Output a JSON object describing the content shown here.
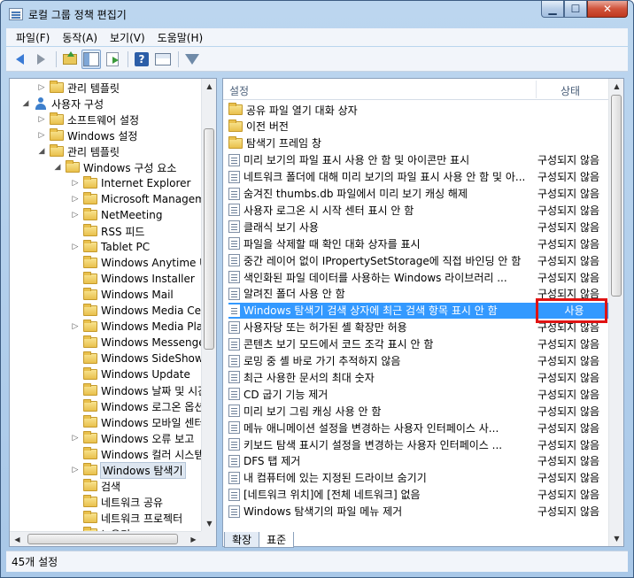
{
  "window": {
    "title": "로컬 그룹 정책 편집기"
  },
  "menu": {
    "items": [
      "파일(F)",
      "동작(A)",
      "보기(V)",
      "도움말(H)"
    ]
  },
  "toolbar": {
    "icons": [
      "back-arrow-icon",
      "forward-arrow-icon",
      "folder-up-icon",
      "console-tree-icon",
      "export-icon",
      "help-icon",
      "view-icon",
      "filter-icon"
    ]
  },
  "tree": {
    "items": [
      {
        "label": "관리 템플릿",
        "indent": 1,
        "toggle": "▷",
        "icon": "folder-icon"
      },
      {
        "label": "사용자 구성",
        "indent": 0,
        "toggle": "◢",
        "icon": "user-icon"
      },
      {
        "label": "소프트웨어 설정",
        "indent": 1,
        "toggle": "▷",
        "icon": "folder-icon"
      },
      {
        "label": "Windows 설정",
        "indent": 1,
        "toggle": "▷",
        "icon": "folder-icon"
      },
      {
        "label": "관리 템플릿",
        "indent": 1,
        "toggle": "◢",
        "icon": "folder-icon"
      },
      {
        "label": "Windows 구성 요소",
        "indent": 2,
        "toggle": "◢",
        "icon": "folder-icon"
      },
      {
        "label": "Internet Explorer",
        "indent": 3,
        "toggle": "▷",
        "icon": "folder-icon"
      },
      {
        "label": "Microsoft Management",
        "indent": 3,
        "toggle": "▷",
        "icon": "folder-icon"
      },
      {
        "label": "NetMeeting",
        "indent": 3,
        "toggle": "▷",
        "icon": "folder-icon"
      },
      {
        "label": "RSS 피드",
        "indent": 3,
        "toggle": "",
        "icon": "folder-icon"
      },
      {
        "label": "Tablet PC",
        "indent": 3,
        "toggle": "▷",
        "icon": "folder-icon"
      },
      {
        "label": "Windows Anytime Upgrade",
        "indent": 3,
        "toggle": "",
        "icon": "folder-icon"
      },
      {
        "label": "Windows Installer",
        "indent": 3,
        "toggle": "",
        "icon": "folder-icon"
      },
      {
        "label": "Windows Mail",
        "indent": 3,
        "toggle": "",
        "icon": "folder-icon"
      },
      {
        "label": "Windows Media Center",
        "indent": 3,
        "toggle": "",
        "icon": "folder-icon"
      },
      {
        "label": "Windows Media Player",
        "indent": 3,
        "toggle": "▷",
        "icon": "folder-icon"
      },
      {
        "label": "Windows Messenger",
        "indent": 3,
        "toggle": "",
        "icon": "folder-icon"
      },
      {
        "label": "Windows SideShow",
        "indent": 3,
        "toggle": "",
        "icon": "folder-icon"
      },
      {
        "label": "Windows Update",
        "indent": 3,
        "toggle": "",
        "icon": "folder-icon"
      },
      {
        "label": "Windows 날짜 및 시간",
        "indent": 3,
        "toggle": "",
        "icon": "folder-icon"
      },
      {
        "label": "Windows 로그온 옵션",
        "indent": 3,
        "toggle": "",
        "icon": "folder-icon"
      },
      {
        "label": "Windows 모바일 센터",
        "indent": 3,
        "toggle": "",
        "icon": "folder-icon"
      },
      {
        "label": "Windows 오류 보고",
        "indent": 3,
        "toggle": "▷",
        "icon": "folder-icon"
      },
      {
        "label": "Windows 컬러 시스템",
        "indent": 3,
        "toggle": "",
        "icon": "folder-icon"
      },
      {
        "label": "Windows 탐색기",
        "indent": 3,
        "toggle": "▷",
        "icon": "folder-icon",
        "selected": true
      },
      {
        "label": "검색",
        "indent": 3,
        "toggle": "",
        "icon": "folder-icon"
      },
      {
        "label": "네트워크 공유",
        "indent": 3,
        "toggle": "",
        "icon": "folder-icon"
      },
      {
        "label": "네트워크 프로젝터",
        "indent": 3,
        "toggle": "",
        "icon": "folder-icon"
      },
      {
        "label": "노우기",
        "indent": 3,
        "toggle": "",
        "icon": "folder-icon"
      }
    ]
  },
  "list": {
    "headers": {
      "setting": "설정",
      "state": "상태"
    },
    "rows": [
      {
        "name": "공유 파일 열기 대화 상자",
        "state": "",
        "type": "folder"
      },
      {
        "name": "이전 버전",
        "state": "",
        "type": "folder"
      },
      {
        "name": "탐색기 프레임 창",
        "state": "",
        "type": "folder"
      },
      {
        "name": "미리 보기의 파일 표시 사용 안 함 및 아이콘만 표시",
        "state": "구성되지 않음",
        "type": "setting"
      },
      {
        "name": "네트워크 폴더에 대해 미리 보기의 파일 표시 사용 안 함 및 아...",
        "state": "구성되지 않음",
        "type": "setting"
      },
      {
        "name": "숨겨진 thumbs.db 파일에서 미리 보기 캐싱 해제",
        "state": "구성되지 않음",
        "type": "setting"
      },
      {
        "name": "사용자 로그온 시 시작 센터 표시 안 함",
        "state": "구성되지 않음",
        "type": "setting"
      },
      {
        "name": "클래식 보기 사용",
        "state": "구성되지 않음",
        "type": "setting"
      },
      {
        "name": "파일을 삭제할 때 확인 대화 상자를 표시",
        "state": "구성되지 않음",
        "type": "setting"
      },
      {
        "name": "중간 레이어 없이 IPropertySetStorage에 직접 바인딩 안 함",
        "state": "구성되지 않음",
        "type": "setting"
      },
      {
        "name": "색인화된 파일 데이터를 사용하는 Windows 라이브러리 ...",
        "state": "구성되지 않음",
        "type": "setting"
      },
      {
        "name": "알려진 폴더 사용 안 함",
        "state": "구성되지 않음",
        "type": "setting"
      },
      {
        "name": "Windows 탐색기 검색 상자에 최근 검색 항목 표시 안 함",
        "state": "사용",
        "type": "setting",
        "highlighted": true
      },
      {
        "name": "사용자당 또는 허가된 셸 확장만 허용",
        "state": "구성되지 않음",
        "type": "setting"
      },
      {
        "name": "콘텐츠 보기 모드에서 코드 조각 표시 안 함",
        "state": "구성되지 않음",
        "type": "setting"
      },
      {
        "name": "로밍 중 셸 바로 가기 추적하지 않음",
        "state": "구성되지 않음",
        "type": "setting"
      },
      {
        "name": "최근 사용한 문서의 최대 숫자",
        "state": "구성되지 않음",
        "type": "setting"
      },
      {
        "name": "CD 굽기 기능 제거",
        "state": "구성되지 않음",
        "type": "setting"
      },
      {
        "name": "미리 보기 그림 캐싱 사용 안 함",
        "state": "구성되지 않음",
        "type": "setting"
      },
      {
        "name": "메뉴 애니메이션 설정을 변경하는 사용자 인터페이스 사...",
        "state": "구성되지 않음",
        "type": "setting"
      },
      {
        "name": "키보드 탐색 표시기 설정을 변경하는 사용자 인터페이스 ...",
        "state": "구성되지 않음",
        "type": "setting"
      },
      {
        "name": "DFS 탭 제거",
        "state": "구성되지 않음",
        "type": "setting"
      },
      {
        "name": "내 컴퓨터에 있는 지정된 드라이브 숨기기",
        "state": "구성되지 않음",
        "type": "setting"
      },
      {
        "name": "[네트워크 위치]에 [전체 네트워크] 없음",
        "state": "구성되지 않음",
        "type": "setting"
      },
      {
        "name": "Windows 탐색기의 파일 메뉴 제거",
        "state": "구성되지 않음",
        "type": "setting"
      }
    ]
  },
  "tabs": [
    "확장",
    "표준"
  ],
  "tabs_active": "표준",
  "status": {
    "text": "45개 설정"
  },
  "colors": {
    "highlight": "#3399ff",
    "annotation_box": "#e01313"
  }
}
